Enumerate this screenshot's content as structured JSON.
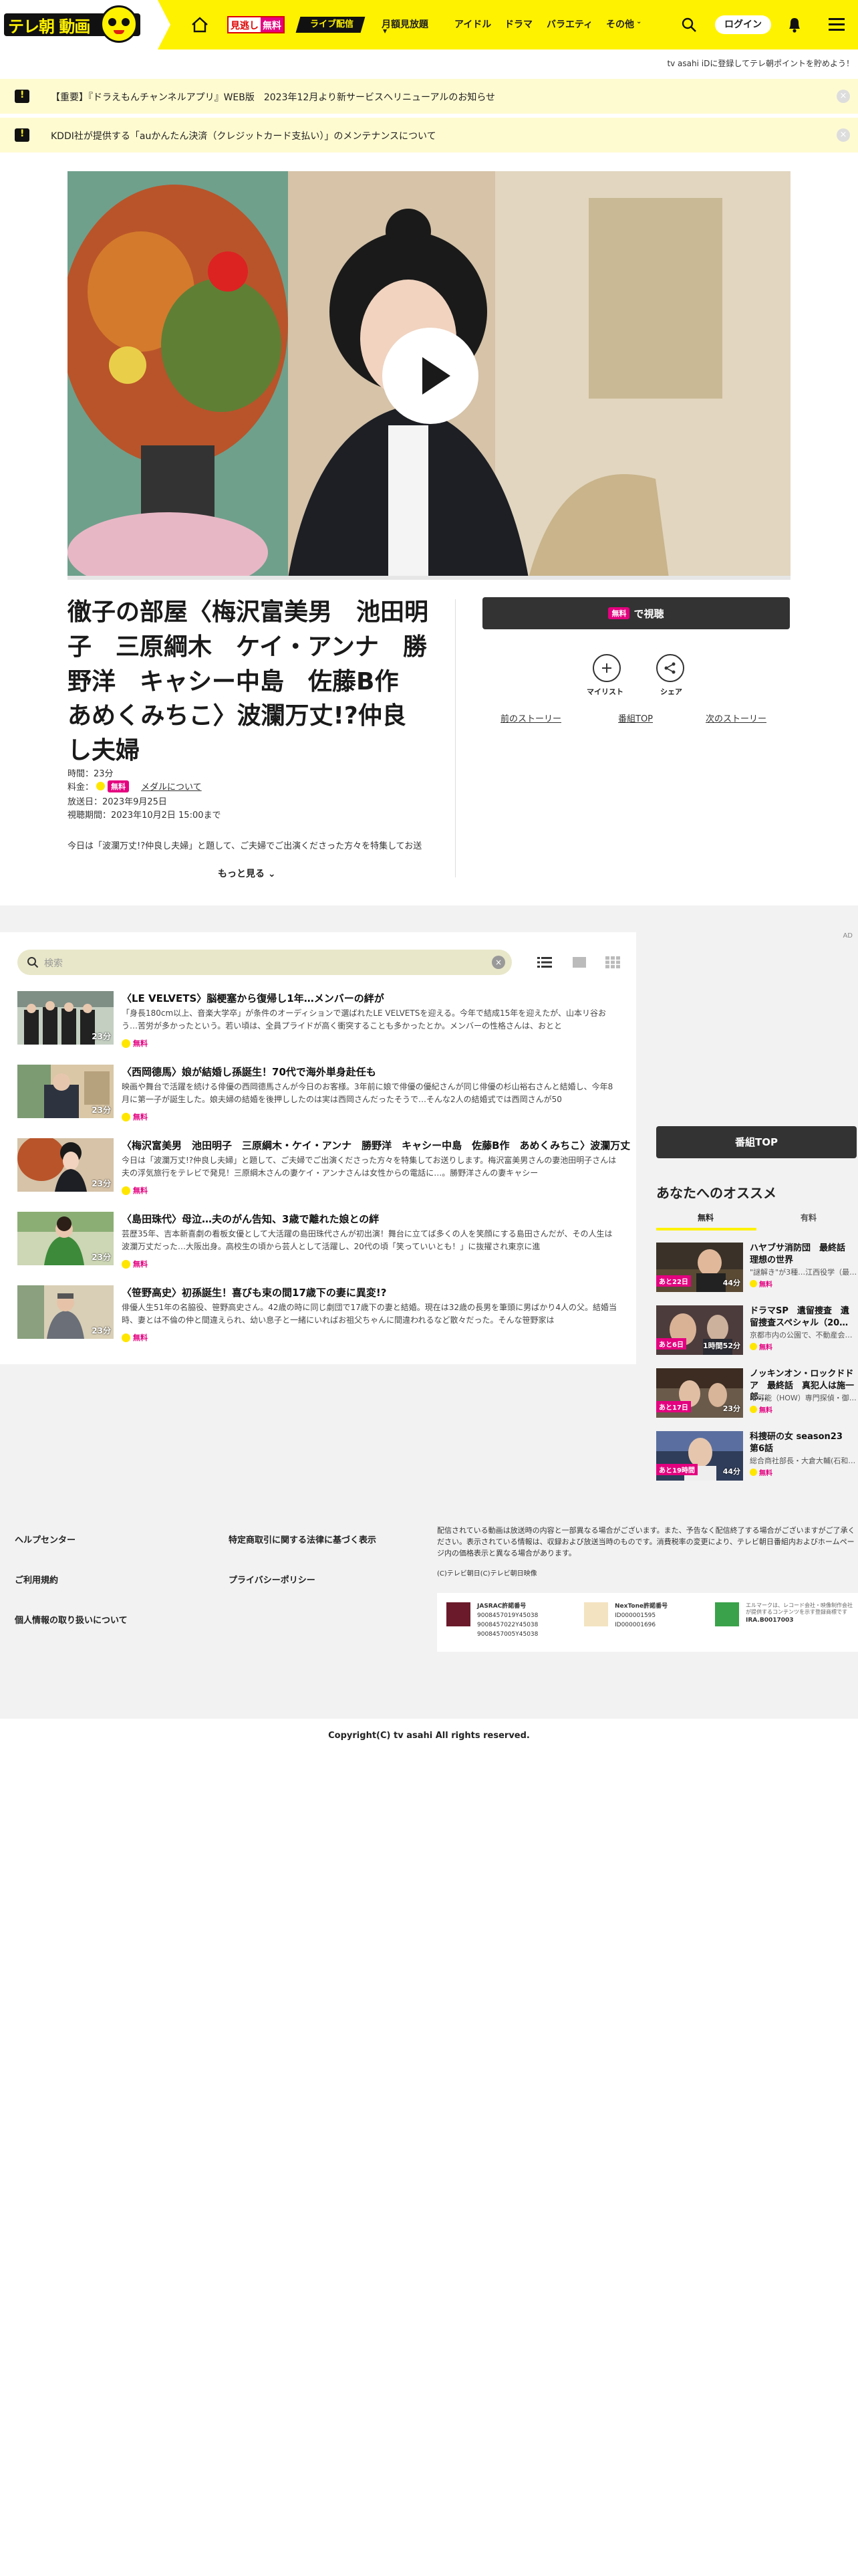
{
  "header": {
    "logo_text": "テレ朝 動画",
    "mitai_left": "見逃し",
    "mitai_right": "無料",
    "live_label": "ライブ配信",
    "nav": [
      "月額見放題",
      "アイドル",
      "ドラマ",
      "バラエティ",
      "その他"
    ],
    "login": "ログイン",
    "promo": "tv asahi iDに登録してテレ朝ポイントを貯めよう！",
    "accent_color": "#fff200"
  },
  "notices": [
    {
      "text": "【重要】『ドラえもんチャンネルアプリ』WEB版　2023年12月より新サービスへリニューアルのお知らせ"
    },
    {
      "text": "KDDI社が提供する「auかんたん決済（クレジットカード支払い）」のメンテナンスについて"
    }
  ],
  "episode": {
    "title": "徹子の部屋〈梅沢富美男　池田明子　三原綱木　ケイ・アンナ　勝野洋　キャシー中島　佐藤B作　あめくみちこ〉波瀾万丈!?仲良し夫婦",
    "time": "時間：23分",
    "price_label": "料金：",
    "price_free": "無料",
    "medal_link": "メダルについて",
    "aired": "放送日：2023年9月25日",
    "period": "視聴期間：2023年10月2日 15:00まで",
    "description": "今日は「波瀾万丈!?仲良し夫婦」と題して、ご夫婦でご出演くださった方々を特集してお送",
    "more": "もっと見る",
    "watch_free": "無料",
    "watch_label": "で視聴",
    "mylist": "マイリスト",
    "share": "シェア",
    "prev": "前のストーリー",
    "program_top": "番組TOP",
    "next": "次のストーリー"
  },
  "list": {
    "search_placeholder": "検索",
    "episodes": [
      {
        "title": "〈LE VELVETS〉脳梗塞から復帰し1年…メンバーの絆が",
        "desc": "「身長180cm以上、音楽大学卒」が条件のオーディションで選ばれたLE VELVETSを迎える。今年で結成15年を迎えたが、山本リ谷おう…苦労が多かったという。若い頃は、全員プライドが高く衝突することも多かったとか。メンバーの性格さんは、おとと",
        "duration": "23分",
        "free": "無料"
      },
      {
        "title": "〈西岡德馬〉娘が結婚し孫誕生！70代で海外単身赴任も",
        "desc": "映画や舞台で活躍を続ける俳優の西岡德馬さんが今日のお客様。3年前に娘で俳優の優紀さんが同じ俳優の杉山裕右さんと結婚し、今年8月に第一子が誕生した。娘夫婦の結婚を後押ししたのは実は西岡さんだったそうで…そんな2人の結婚式では西岡さんが50",
        "duration": "23分",
        "free": "無料"
      },
      {
        "title": "〈梅沢富美男　池田明子　三原綱木・ケイ・アンナ　勝野洋　キャシー中島　佐藤B作　あめくみちこ〉波瀾万丈",
        "desc": "今日は「波瀾万丈!?仲良し夫婦」と題して、ご夫婦でご出演くださった方々を特集してお送りします。梅沢富美男さんの妻池田明子さんは夫の浮気旅行をテレビで発見！三原綱木さんの妻ケイ・アンナさんは女性からの電話に…。勝野洋さんの妻キャシー",
        "duration": "23分",
        "free": "無料"
      },
      {
        "title": "〈島田珠代〉母泣…夫のがん告知、3歳で離れた娘との絆",
        "desc": "芸歴35年、吉本新喜劇の看板女優として大活躍の島田珠代さんが初出演！舞台に立てば多くの人を笑顔にする島田さんだが、その人生は波瀾万丈だった…大阪出身。高校生の頃から芸人として活躍し、20代の頃「笑っていいとも！」に抜擢され東京に進",
        "duration": "23分",
        "free": "無料"
      },
      {
        "title": "〈笹野高史〉初孫誕生！喜びも束の間17歳下の妻に異変!?",
        "desc": "俳優人生51年の名脇役、笹野高史さん。42歳の時に同じ劇団で17歳下の妻と結婚。現在は32歳の長男を筆頭に男ばかり4人の父。結婚当時、妻とは不倫の仲と間違えられ、幼い息子と一緒にいればお祖父ちゃんに間違われるなど散々だった。そんな笹野家は",
        "duration": "23分",
        "free": "無料"
      }
    ]
  },
  "side": {
    "ad_label": "AD",
    "program_top": "番組TOP",
    "recommend_title": "あなたへのオススメ",
    "tabs": [
      "無料",
      "有料"
    ],
    "cards": [
      {
        "badge": "あと22日",
        "duration": "44分",
        "title": "ハヤブサ消防団　最終話　理想の世界",
        "sub": "\"謎解き\"が3種…江西役学（最…",
        "free": "無料"
      },
      {
        "badge": "あと6日",
        "duration": "1時間52分",
        "title": "ドラマSP　遺留捜査　遺留捜査スペシャル（20…",
        "sub": "京都市内の公園で、不動産会…",
        "free": "無料"
      },
      {
        "badge": "あと17日",
        "duration": "23分",
        "title": "ノッキンオン・ロックドドア　最終話　真犯人は施一郎…",
        "sub": "不可能（HOW）専門探偵・御…",
        "free": "無料"
      },
      {
        "badge": "あと19時間",
        "duration": "44分",
        "title": "科捜研の女 season23　第6話",
        "sub": "総合商社部長・大倉大輔(石和…",
        "free": "無料"
      }
    ]
  },
  "footer": {
    "col1": [
      "ヘルプセンター",
      "ご利用規約",
      "個人情報の取り扱いについて"
    ],
    "col2": [
      "特定商取引に関する法律に基づく表示",
      "プライバシーポリシー"
    ],
    "note": "配信されている動画は放送時の内容と一部異なる場合がございます。また、予告なく配信終了する場合がございますがご了承ください。表示されている情報は、収録および放送当時のものです。消費税率の変更により、テレビ朝日番組内およびホームページ内の価格表示と異なる場合があります。",
    "copy_small": "(C)テレビ朝日(C)テレビ朝日映像",
    "jasrac_title": "JASRAC許諾番号",
    "jasrac_nums": [
      "9008457019Y45038",
      "9008457022Y45038",
      "9008457005Y45038"
    ],
    "nextone_title": "NexTone許諾番号",
    "nextone_nums": [
      "ID000001595",
      "ID000001696"
    ],
    "elmark_text": "エルマークは、レコード会社・映像制作会社が提供するコンテンツを示す登録商標です",
    "elmark_num": "IRA.B0017003",
    "copyright": "Copyright(C) tv asahi All rights reserved."
  }
}
